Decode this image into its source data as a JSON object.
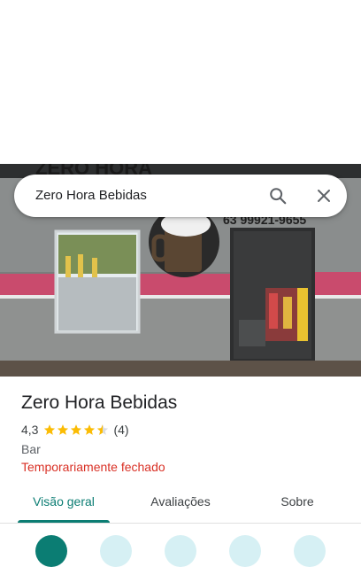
{
  "search": {
    "query": "Zero Hora Bebidas"
  },
  "photo": {
    "sign_text": "ZERO HORA",
    "phone_text": "63 99921-9655"
  },
  "place": {
    "name": "Zero Hora Bebidas",
    "rating": "4,3",
    "rating_value": 4.3,
    "review_count": "(4)",
    "category": "Bar",
    "status": "Temporariamente fechado"
  },
  "tabs": [
    {
      "label": "Visão geral",
      "active": true
    },
    {
      "label": "Avaliações",
      "active": false
    },
    {
      "label": "Sobre",
      "active": false
    }
  ],
  "colors": {
    "accent": "#0b7d73",
    "closed": "#d93025",
    "star": "#fbbc04"
  }
}
